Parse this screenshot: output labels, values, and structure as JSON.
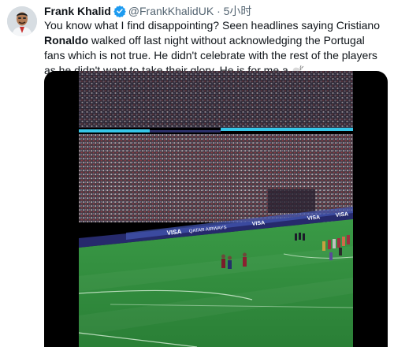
{
  "author": {
    "name": "Frank Khalid",
    "handle": "@FrankKhalidUK",
    "separator": "·",
    "time": "5小时",
    "verified": true
  },
  "tweet": {
    "text_part1": "You know what I find disappointing? Seen headlines saying Cristiano ",
    "text_bold": "Ronaldo",
    "text_part2": " walked off last night without acknowledging the Portugal fans which is not true. He didn't celebrate with the rest of the players as he didn't want to take their glory. He is for me a ",
    "emoji_icon": "goat-emoji-icon"
  },
  "media": {
    "type": "video",
    "description_icon": "stadium-video-frame",
    "ad_boards": [
      "VISA",
      "QATAR AIRWAYS",
      "VISA",
      "VISA",
      "VISA"
    ]
  },
  "colors": {
    "verified_blue": "#1d9bf0",
    "text_primary": "#0f1419",
    "text_secondary": "#536471",
    "pitch_green": "#2f8a3c"
  }
}
